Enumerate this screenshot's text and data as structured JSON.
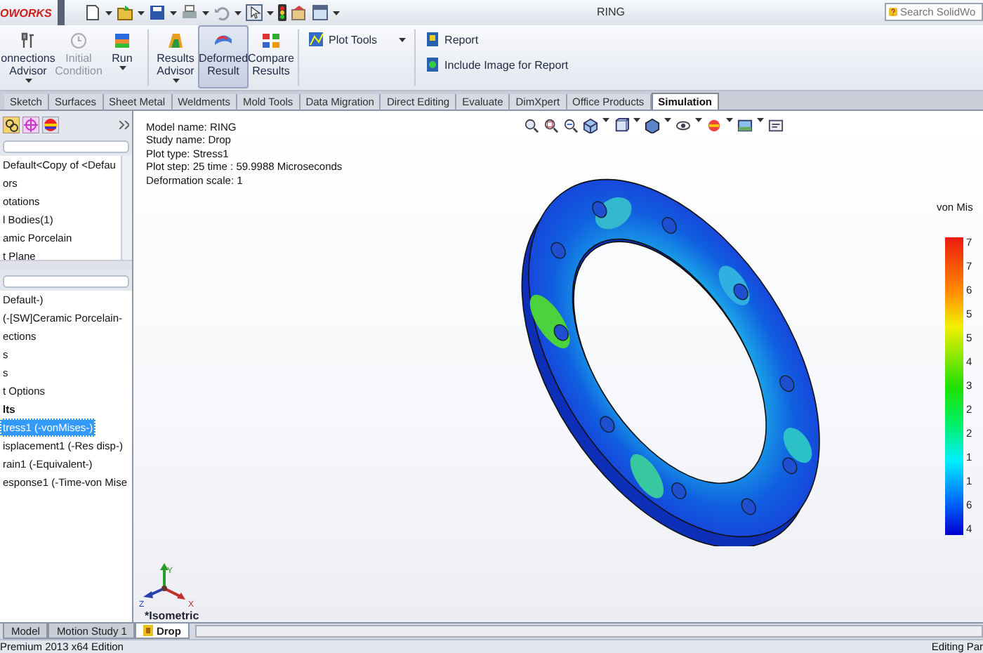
{
  "title_bar": {
    "logo": "OWORKS",
    "title": "RING",
    "search": {
      "placeholder": "Search SolidWo"
    }
  },
  "ribbon": {
    "buttons": [
      {
        "kind": "large",
        "label": "onnections Advisor",
        "dropdown": true,
        "disabled": false,
        "selected": false
      },
      {
        "kind": "large",
        "label": "Initial Condition",
        "dropdown": false,
        "disabled": true,
        "selected": false
      },
      {
        "kind": "large",
        "label": "Run",
        "dropdown": true,
        "disabled": false,
        "selected": false
      },
      {
        "kind": "large",
        "label": "Results Advisor",
        "dropdown": true,
        "disabled": false,
        "selected": false
      },
      {
        "kind": "large",
        "label": "Deformed Result",
        "dropdown": false,
        "disabled": false,
        "selected": true
      },
      {
        "kind": "large",
        "label": "Compare Results",
        "dropdown": false,
        "disabled": false,
        "selected": false
      },
      {
        "kind": "small",
        "label": "Plot Tools",
        "dropdown": true,
        "disabled": false,
        "selected": false
      },
      {
        "kind": "small",
        "label": "Report",
        "dropdown": false,
        "disabled": false,
        "selected": false
      },
      {
        "kind": "small",
        "label": "Include Image for Report",
        "dropdown": false,
        "disabled": false,
        "selected": false
      }
    ]
  },
  "tabs": [
    {
      "label": "Sketch",
      "selected": false
    },
    {
      "label": "Surfaces",
      "selected": false
    },
    {
      "label": "Sheet Metal",
      "selected": false
    },
    {
      "label": "Weldments",
      "selected": false
    },
    {
      "label": "Mold Tools",
      "selected": false
    },
    {
      "label": "Data Migration",
      "selected": false
    },
    {
      "label": "Direct Editing",
      "selected": false
    },
    {
      "label": "Evaluate",
      "selected": false
    },
    {
      "label": "DimXpert",
      "selected": false
    },
    {
      "label": "Office Products",
      "selected": false
    },
    {
      "label": "Simulation",
      "selected": true
    }
  ],
  "feature_tree": {
    "items": [
      {
        "label": "Default<Copy of <Defau",
        "selected": false
      },
      {
        "label": "ors",
        "selected": false
      },
      {
        "label": "otations",
        "selected": false
      },
      {
        "label": "l Bodies(1)",
        "selected": false
      },
      {
        "label": "amic Porcelain",
        "selected": false
      },
      {
        "label": "t Plane",
        "selected": false
      }
    ]
  },
  "study_tree": {
    "items": [
      {
        "label": "Default-)",
        "kind": "item",
        "selected": false
      },
      {
        "label": "(-[SW]Ceramic Porcelain-",
        "kind": "item",
        "selected": false
      },
      {
        "label": "ections",
        "kind": "item",
        "selected": false
      },
      {
        "label": "s",
        "kind": "item",
        "selected": false
      },
      {
        "label": "s",
        "kind": "item",
        "selected": false
      },
      {
        "label": "t Options",
        "kind": "item",
        "selected": false
      },
      {
        "label": "lts",
        "kind": "heading",
        "selected": false
      },
      {
        "label": "tress1 (-vonMises-)",
        "kind": "item",
        "selected": true
      },
      {
        "label": "isplacement1 (-Res disp-)",
        "kind": "item",
        "selected": false
      },
      {
        "label": "rain1 (-Equivalent-)",
        "kind": "item",
        "selected": false
      },
      {
        "label": "esponse1 (-Time-von Mise",
        "kind": "item",
        "selected": false
      }
    ]
  },
  "viewport": {
    "info": [
      "Model name: RING",
      "Study name: Drop",
      "Plot type:  Stress1",
      "Plot step: 25   time : 59.9988 Microseconds",
      "Deformation scale: 1"
    ],
    "legend": {
      "title": "von Mis",
      "tick_labels": [
        "7",
        "7",
        "6",
        "5",
        "5",
        "4",
        "3",
        "2",
        "2",
        "1",
        "1",
        "6",
        "4"
      ]
    },
    "triad": {
      "x": "X",
      "y": "Y",
      "z": "Z"
    },
    "view_label": "*Isometric"
  },
  "bottom_tabs": [
    {
      "label": "Model",
      "selected": false
    },
    {
      "label": "Motion Study 1",
      "selected": false
    },
    {
      "label": "Drop",
      "selected": true
    }
  ],
  "status_bar": {
    "left": "Premium 2013 x64 Edition",
    "right": "Editing Par"
  }
}
